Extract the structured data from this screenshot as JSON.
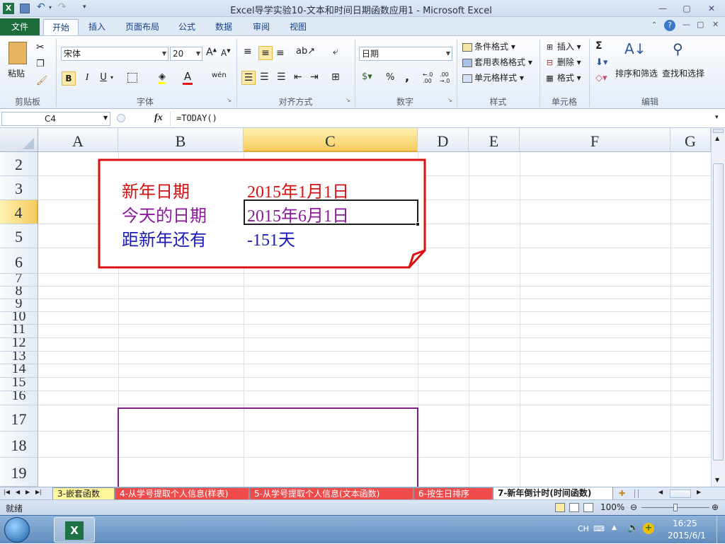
{
  "window": {
    "title": "Excel导学实验10-文本和时间日期函数应用1 - Microsoft Excel",
    "controls": [
      "—",
      "▢",
      "✕"
    ]
  },
  "tabs": {
    "file": "文件",
    "items": [
      "开始",
      "插入",
      "页面布局",
      "公式",
      "数据",
      "审阅",
      "视图"
    ],
    "active": "开始"
  },
  "ribbon": {
    "clipboard": {
      "paste": "粘贴",
      "label": "剪贴板"
    },
    "font": {
      "name": "宋体",
      "size": "20",
      "bold": "B",
      "italic": "I",
      "underline": "U",
      "font_color_letter": "A",
      "phonetic": "wén",
      "label": "字体"
    },
    "alignment": {
      "label": "对齐方式"
    },
    "number": {
      "format": "日期",
      "percent": "%",
      "comma": ",",
      "inc": "←.0 .00",
      "dec": ".00 →.0",
      "label": "数字"
    },
    "styles": {
      "conditional": "条件格式",
      "table": "套用表格格式",
      "cell": "单元格样式",
      "label": "样式"
    },
    "cells": {
      "insert": "插入",
      "delete": "删除",
      "format": "格式",
      "label": "单元格"
    },
    "editing": {
      "sigma": "Σ",
      "sort": "排序和筛选",
      "find": "查找和选择",
      "label": "编辑"
    }
  },
  "formula_bar": {
    "name_box": "C4",
    "fx": "fx",
    "formula": "=TODAY()"
  },
  "sheet": {
    "columns": [
      "A",
      "B",
      "C",
      "D",
      "E",
      "F",
      "G"
    ],
    "rows": [
      "2",
      "3",
      "4",
      "5",
      "6",
      "7",
      "8",
      "9",
      "10",
      "11",
      "12",
      "13",
      "14",
      "15",
      "16",
      "17",
      "18",
      "19"
    ],
    "active_cell": "C4",
    "cells": {
      "B3": "新年日期",
      "C3": "2015年1月1日",
      "B4": "今天的日期",
      "C4": "2015年6月1日",
      "B5": "距新年还有",
      "C5": "-151天"
    },
    "colors": {
      "b3": "#d81010",
      "c3": "#d81010",
      "b4": "#8b1a9a",
      "c4": "#8b1a9a",
      "b5": "#1a1ab4",
      "c5": "#1a1ab4",
      "callout_border": "#d81010",
      "purple_box": "#7a2080"
    }
  },
  "sheet_tabs": [
    {
      "label": "3-嵌套函数",
      "color": "#fff79a"
    },
    {
      "label": "4-从学号提取个人信息(样表)",
      "color": "#f04b4b"
    },
    {
      "label": "5-从学号提取个人信息(文本函数)",
      "color": "#f04b4b"
    },
    {
      "label": "6-按生日排序",
      "color": "#f04b4b"
    },
    {
      "label": "7-新年倒计时(时间函数)",
      "color": "#ffffff"
    }
  ],
  "status": {
    "ready": "就绪",
    "zoom": "100%"
  },
  "taskbar": {
    "lang": "CH",
    "time": "16:25",
    "date": "2015/6/1"
  }
}
